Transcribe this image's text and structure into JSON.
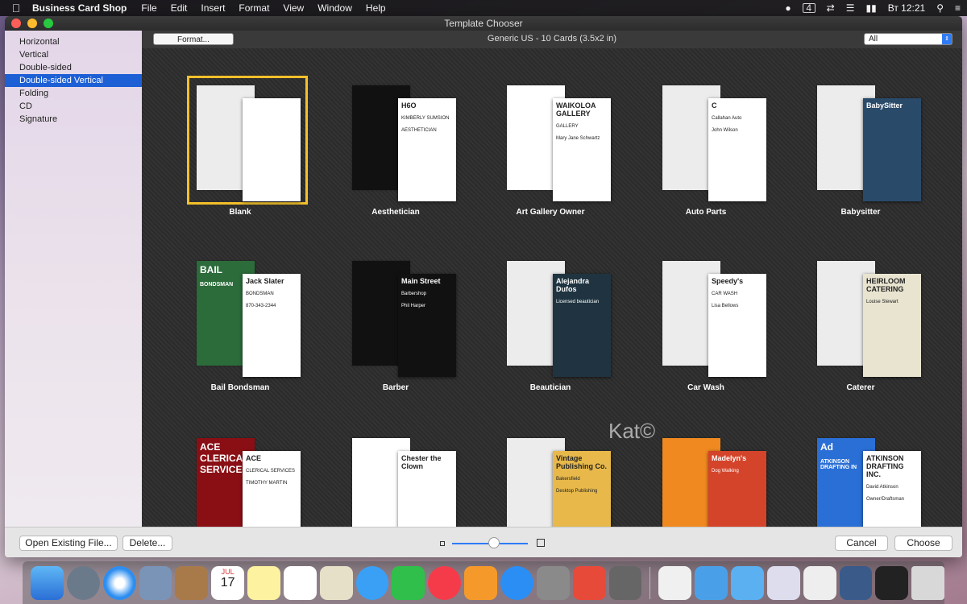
{
  "menubar": {
    "app_name": "Business Card Shop",
    "items": [
      "File",
      "Edit",
      "Insert",
      "Format",
      "View",
      "Window",
      "Help"
    ],
    "status": {
      "clock": "Вт 12:21",
      "calendar_day": "4"
    }
  },
  "window": {
    "title": "Template Chooser"
  },
  "sidebar": {
    "items": [
      {
        "label": "Horizontal",
        "selected": false
      },
      {
        "label": "Vertical",
        "selected": false
      },
      {
        "label": "Double-sided",
        "selected": false
      },
      {
        "label": "Double-sided Vertical",
        "selected": true
      },
      {
        "label": "Folding",
        "selected": false
      },
      {
        "label": "CD",
        "selected": false
      },
      {
        "label": "Signature",
        "selected": false
      }
    ]
  },
  "toolbar": {
    "format_button": "Format...",
    "format_title": "Generic US - 10 Cards (3.5x2 in)",
    "filter_value": "All"
  },
  "templates": [
    {
      "label": "Blank",
      "selected": true,
      "front_color": "#ffffff",
      "back_color": "#ececec"
    },
    {
      "label": "Aesthetician",
      "selected": false,
      "front_color": "#ffffff",
      "back_color": "#111111",
      "text": "H6O",
      "subtext": "KIMBERLY SUMSION",
      "subtext2": "AESTHETICIAN"
    },
    {
      "label": "Art Gallery Owner",
      "selected": false,
      "front_color": "#ffffff",
      "back_color": "#ffffff",
      "text": "WAIKOLOA GALLERY",
      "subtext": "GALLERY",
      "subtext2": "Mary Jane Schwartz"
    },
    {
      "label": "Auto Parts",
      "selected": false,
      "front_color": "#ffffff",
      "back_color": "#ececec",
      "text": "C",
      "subtext": "Callahan Auto",
      "subtext2": "John Wilson"
    },
    {
      "label": "Babysitter",
      "selected": false,
      "front_color": "#2a4a6a",
      "back_color": "#ececec",
      "text": "BabySitter"
    },
    {
      "label": "Bail Bondsman",
      "selected": false,
      "front_color": "#ffffff",
      "back_color": "#2c6b3a",
      "text": "Jack Slater",
      "subtext": "BONDSMAN",
      "subtext2": "870-343-2344",
      "back_text": "BAIL",
      "back_text2": "BONDSMAN"
    },
    {
      "label": "Barber",
      "selected": false,
      "front_color": "#111111",
      "back_color": "#111111",
      "text": "Main Street",
      "subtext": "Barbershop",
      "subtext2": "Phil Harper"
    },
    {
      "label": "Beautician",
      "selected": false,
      "front_color": "#1f3440",
      "back_color": "#ececec",
      "text": "Alejandra Dufos",
      "subtext": "Licensed beautician"
    },
    {
      "label": "Car Wash",
      "selected": false,
      "front_color": "#ffffff",
      "back_color": "#ececec",
      "text": "Speedy's",
      "subtext": "CAR WASH",
      "subtext2": "Lisa Bellows"
    },
    {
      "label": "Caterer",
      "selected": false,
      "front_color": "#e8e4d0",
      "back_color": "#ececec",
      "text": "HEIRLOOM CATERING",
      "subtext": "Louise Stewart"
    },
    {
      "label": "",
      "selected": false,
      "front_color": "#ffffff",
      "back_color": "#8a0f14",
      "text": "ACE",
      "subtext": "CLERICAL SERVICES",
      "subtext2": "TIMOTHY MARTIN",
      "back_text": "ACE CLERICAL SERVICES"
    },
    {
      "label": "",
      "selected": false,
      "front_color": "#ffffff",
      "back_color": "#ffffff",
      "text": "Chester the Clown",
      "back_text": "Chester"
    },
    {
      "label": "",
      "selected": false,
      "front_color": "#e8b94a",
      "back_color": "#ececec",
      "text": "Vintage Publishing Co.",
      "subtext": "Bakersfield",
      "subtext2": "Desktop Publishing"
    },
    {
      "label": "",
      "selected": false,
      "front_color": "#d4442a",
      "back_color": "#f08a20",
      "text": "Madelyn's",
      "subtext": "Dog Walking"
    },
    {
      "label": "",
      "selected": false,
      "front_color": "#ffffff",
      "back_color": "#2a6fd6",
      "text": "ATKINSON DRAFTING INC.",
      "subtext": "David Atkinson",
      "subtext2": "Owner/Draftsman",
      "back_text": "Ad",
      "back_text2": "ATKINSON DRAFTING IN"
    }
  ],
  "watermark": "Kat©",
  "bottombar": {
    "open_button": "Open Existing File...",
    "delete_button": "Delete...",
    "cancel_button": "Cancel",
    "choose_button": "Choose",
    "zoom_level": 0.55
  },
  "dock": {
    "calendar_month": "JUL",
    "calendar_day": "17"
  },
  "colors": {
    "accent": "#2f7bf5",
    "selection": "#f2c02a",
    "sidebar_selected": "#1d5fd5"
  }
}
